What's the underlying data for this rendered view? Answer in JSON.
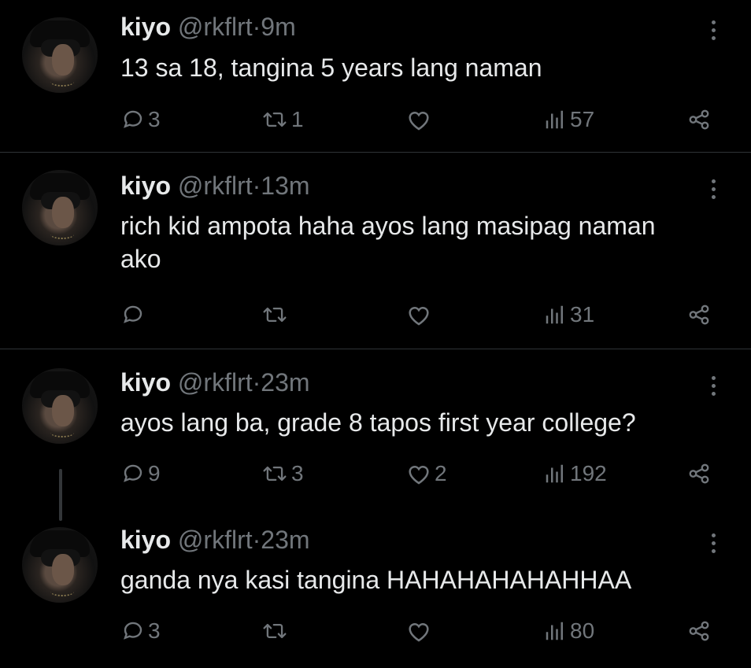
{
  "tweets": [
    {
      "name": "kiyo",
      "handle": "@rkflrt",
      "dot": "·",
      "time": "9m",
      "text": "13 sa 18, tangina 5 years lang naman",
      "replies": "3",
      "retweets": "1",
      "likes": "",
      "views": "57"
    },
    {
      "name": "kiyo",
      "handle": "@rkflrt",
      "dot": "·",
      "time": "13m",
      "text": "rich kid ampota haha ayos lang masipag naman ako",
      "replies": "",
      "retweets": "",
      "likes": "",
      "views": "31"
    },
    {
      "name": "kiyo",
      "handle": "@rkflrt",
      "dot": "·",
      "time": "23m",
      "text": "ayos lang ba, grade 8 tapos first year college?",
      "replies": "9",
      "retweets": "3",
      "likes": "2",
      "views": "192"
    },
    {
      "name": "kiyo",
      "handle": "@rkflrt",
      "dot": "·",
      "time": "23m",
      "text": "ganda nya kasi tangina HAHAHAHAHAHHAA",
      "replies": "3",
      "retweets": "",
      "likes": "",
      "views": "80"
    }
  ],
  "icons": {
    "reply": "reply-icon",
    "retweet": "retweet-icon",
    "like": "heart-icon",
    "views": "views-icon",
    "share": "share-icon",
    "more": "more-icon"
  },
  "colors": {
    "background": "#000000",
    "text": "#e7e9ea",
    "muted": "#71767b",
    "divider": "#2f3336"
  }
}
